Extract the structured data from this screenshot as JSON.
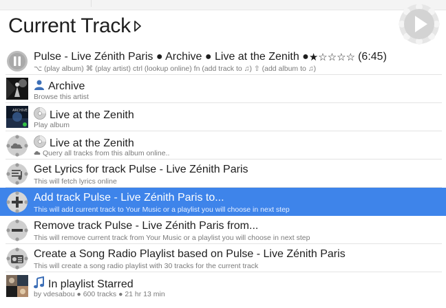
{
  "header": {
    "title": "Current Track"
  },
  "rows": [
    {
      "title": "Pulse - Live Zénith Paris ● Archive ● Live at the Zenith ● ",
      "stars": "★☆☆☆☆",
      "duration": "(6:45)",
      "subtitle": "⌥ (play album) ⌘ (play artist) ctrl (lookup online) fn (add track to ♫) ⇧ (add album to ♫)",
      "icon": "pause-icon"
    },
    {
      "title": "Archive",
      "subtitle": "Browse this artist",
      "icon": "artist-icon"
    },
    {
      "title": "Live at the Zenith",
      "subtitle": "Play album",
      "icon": "cd-icon"
    },
    {
      "title": "Live at the Zenith",
      "subtitle": "Query all tracks from this album online..",
      "icon": "cloud-icon"
    },
    {
      "title": "Get Lyrics for track Pulse - Live Zénith Paris",
      "subtitle": "This will fetch lyrics online",
      "icon": "lyrics-icon"
    },
    {
      "title": "Add track Pulse - Live Zénith Paris to...",
      "subtitle": "This will add current track to Your Music or a playlist you will choose in next step",
      "icon": "add-icon"
    },
    {
      "title": "Remove track Pulse - Live Zénith Paris from...",
      "subtitle": "This will remove current track from Your Music or a playlist you will choose in next step",
      "icon": "remove-icon"
    },
    {
      "title": "Create a Song Radio Playlist based on Pulse - Live Zénith Paris",
      "subtitle": "This will create a song radio playlist with 30 tracks for the current track",
      "icon": "radio-icon"
    },
    {
      "title": "In playlist Starred",
      "subtitle": "by vdesabou ● 600 tracks ● 21 hr 13 min",
      "icon": "playlist-icon"
    }
  ],
  "colors": {
    "selection": "#3e84ea",
    "subtitle": "#7a7a7a",
    "icon_gray": "#8e8e8e"
  }
}
